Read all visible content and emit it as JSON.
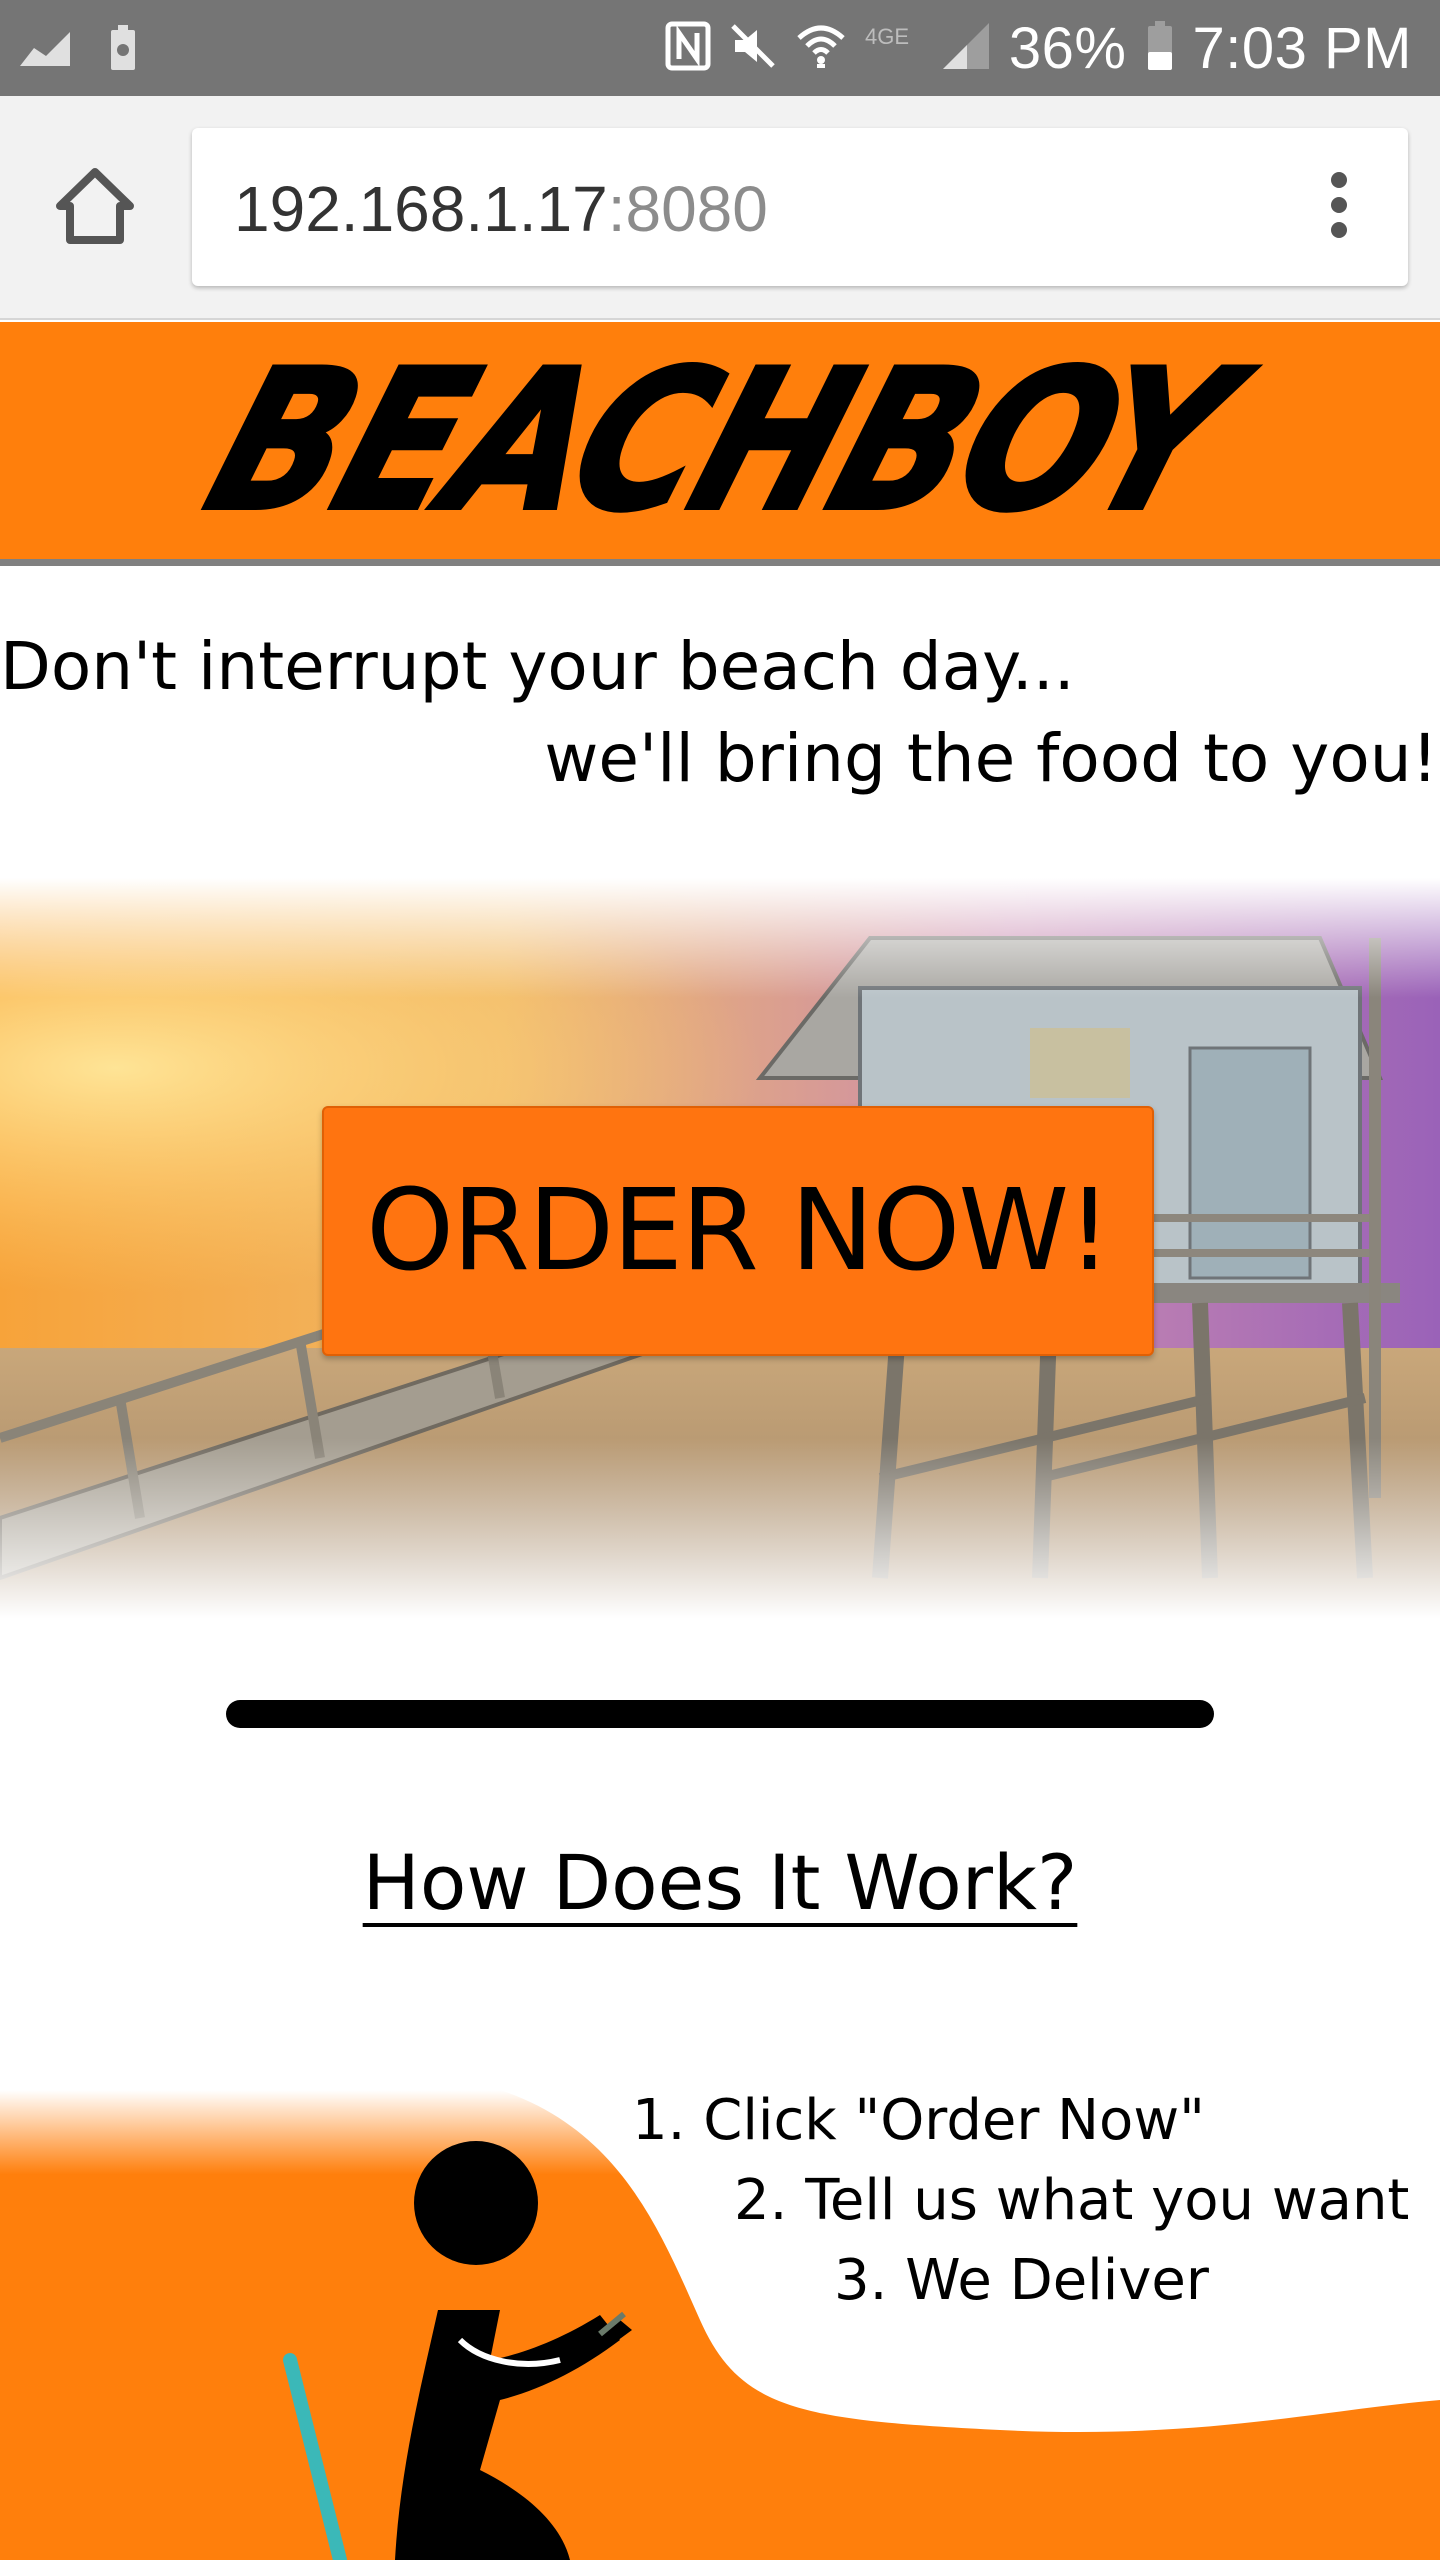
{
  "status_bar": {
    "left_icons": [
      "signal-chart-icon",
      "battery-saver-icon"
    ],
    "right_icons": [
      "nfc-icon",
      "mute-icon",
      "wifi-icon",
      "4g-lte-icon",
      "cell-signal-icon",
      "battery-icon"
    ],
    "battery_percent": "36%",
    "time": "7:03 PM"
  },
  "browser": {
    "url_host": "192.168.1.17",
    "url_port": ":8080",
    "home_icon": "home-icon",
    "menu_icon": "overflow-menu-icon"
  },
  "header": {
    "logo_text": "BEACHBOY",
    "background_color": "#ff7f0c"
  },
  "tagline": {
    "line1": "Don't interrupt your beach day...",
    "line2": "we'll bring the food to you!"
  },
  "hero": {
    "cta_label": "ORDER NOW!",
    "cta_color": "#ff7410"
  },
  "how_it_works": {
    "title": "How Does It Work?",
    "steps": [
      "1. Click \"Order Now\"",
      "2. Tell us what you want",
      "3. We Deliver"
    ]
  }
}
